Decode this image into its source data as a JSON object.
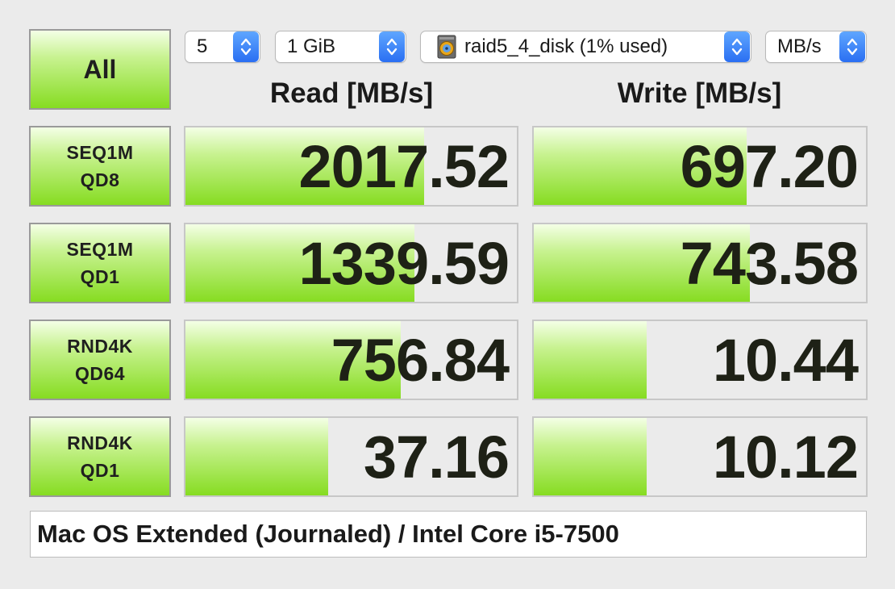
{
  "controls": {
    "all_label": "All",
    "count": "5",
    "size": "1 GiB",
    "drive": "raid5_4_disk (1% used)",
    "unit": "MB/s"
  },
  "headers": {
    "read": "Read [MB/s]",
    "write": "Write [MB/s]"
  },
  "tests": [
    {
      "line1": "SEQ1M",
      "line2": "QD8",
      "read": "2017.52",
      "write": "697.20",
      "read_fill_pct": 72,
      "write_fill_pct": 64
    },
    {
      "line1": "SEQ1M",
      "line2": "QD1",
      "read": "1339.59",
      "write": "743.58",
      "read_fill_pct": 69,
      "write_fill_pct": 65
    },
    {
      "line1": "RND4K",
      "line2": "QD64",
      "read": "756.84",
      "write": "10.44",
      "read_fill_pct": 65,
      "write_fill_pct": 34
    },
    {
      "line1": "RND4K",
      "line2": "QD1",
      "read": "37.16",
      "write": "10.12",
      "read_fill_pct": 43,
      "write_fill_pct": 34
    }
  ],
  "comment": "Mac OS Extended (Journaled) / Intel Core i5-7500",
  "icons": {
    "dropdown": "chevron-updown-icon",
    "drive": "hard-drive-icon"
  },
  "colors": {
    "bar_green": "#86dc21",
    "accent_blue": "#2a6ff2"
  }
}
